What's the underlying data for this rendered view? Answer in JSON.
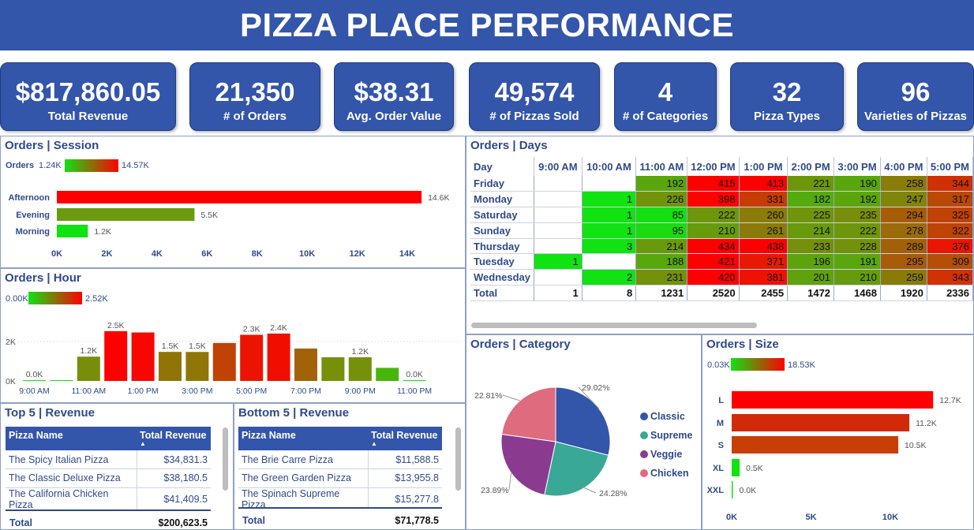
{
  "title": "PIZZA PLACE PERFORMANCE",
  "kpis": [
    {
      "value": "$817,860.05",
      "label": "Total Revenue"
    },
    {
      "value": "21,350",
      "label": "# of Orders"
    },
    {
      "value": "$38.31",
      "label": "Avg. Order Value"
    },
    {
      "value": "49,574",
      "label": "# of Pizzas Sold"
    },
    {
      "value": "4",
      "label": "# of Categories"
    },
    {
      "value": "32",
      "label": "Pizza  Types"
    },
    {
      "value": "96",
      "label": "Varieties of Pizzas"
    }
  ],
  "session": {
    "title": "Orders | Session",
    "legend_label": "Orders",
    "legend_min": "1.24K",
    "legend_max": "14.57K"
  },
  "hour": {
    "title": "Orders | Hour",
    "legend_min": "0.00K",
    "legend_max": "2.52K"
  },
  "days": {
    "title": "Orders | Days",
    "header_day": "Day",
    "hours": [
      "9:00 AM",
      "10:00 AM",
      "11:00 AM",
      "12:00 PM",
      "1:00 PM",
      "2:00 PM",
      "3:00 PM",
      "4:00 PM",
      "5:00 PM"
    ],
    "rows": [
      {
        "day": "Friday",
        "values": [
          "",
          "",
          "192",
          "415",
          "413",
          "221",
          "190",
          "258",
          "344"
        ]
      },
      {
        "day": "Monday",
        "values": [
          "",
          "1",
          "226",
          "398",
          "331",
          "182",
          "192",
          "247",
          "317"
        ]
      },
      {
        "day": "Saturday",
        "values": [
          "",
          "1",
          "85",
          "222",
          "260",
          "225",
          "235",
          "294",
          "325"
        ]
      },
      {
        "day": "Sunday",
        "values": [
          "",
          "1",
          "95",
          "210",
          "261",
          "214",
          "222",
          "278",
          "322"
        ]
      },
      {
        "day": "Thursday",
        "values": [
          "",
          "3",
          "214",
          "434",
          "438",
          "233",
          "228",
          "289",
          "376"
        ]
      },
      {
        "day": "Tuesday",
        "values": [
          "1",
          "",
          "188",
          "421",
          "371",
          "196",
          "191",
          "295",
          "309"
        ]
      },
      {
        "day": "Wednesday",
        "values": [
          "",
          "2",
          "231",
          "420",
          "381",
          "201",
          "210",
          "259",
          "343"
        ]
      }
    ],
    "total_label": "Total",
    "totals": [
      "1",
      "8",
      "1231",
      "2520",
      "2455",
      "1472",
      "1468",
      "1920",
      "2336"
    ]
  },
  "category": {
    "title": "Orders | Category",
    "legend": [
      "Classic",
      "Supreme",
      "Veggie",
      "Chicken"
    ],
    "colors": [
      "#3355aa",
      "#3aa897",
      "#8a3b8f",
      "#de6b7e"
    ]
  },
  "size": {
    "title": "Orders | Size",
    "legend_min": "0.03K",
    "legend_max": "18.53K"
  },
  "top5": {
    "title": "Top 5 | Revenue",
    "col1": "Pizza Name",
    "col2": "Total Revenue",
    "rows": [
      {
        "name": "The Spicy Italian Pizza",
        "value": "$34,831.3"
      },
      {
        "name": "The Classic Deluxe Pizza",
        "value": "$38,180.5"
      },
      {
        "name": "The California Chicken Pizza",
        "value": "$41,409.5"
      }
    ],
    "total_label": "Total",
    "total_value": "$200,623.5"
  },
  "bottom5": {
    "title": "Bottom 5 | Revenue",
    "col1": "Pizza Name",
    "col2": "Total Revenue",
    "rows": [
      {
        "name": "The Brie Carre Pizza",
        "value": "$11,588.5"
      },
      {
        "name": "The Green Garden Pizza",
        "value": "$13,955.8"
      },
      {
        "name": "The Spinach Supreme Pizza",
        "value": "$15,277.8"
      }
    ],
    "total_label": "Total",
    "total_value": "$71,778.5"
  },
  "chart_data": [
    {
      "type": "bar",
      "orientation": "horizontal",
      "categories": [
        "Afternoon",
        "Evening",
        "Morning"
      ],
      "values": [
        14570,
        5500,
        1240
      ],
      "data_labels": [
        "14.6K",
        "5.5K",
        "1.2K"
      ],
      "xticks": [
        "0K",
        "2K",
        "4K",
        "6K",
        "8K",
        "10K",
        "12K",
        "14K"
      ],
      "xlim": [
        0,
        14000
      ],
      "colors": [
        "#ff0000",
        "#6a9a10",
        "#11e211"
      ]
    },
    {
      "type": "bar",
      "hours": [
        9,
        10,
        11,
        12,
        13,
        14,
        15,
        16,
        17,
        18,
        19,
        20,
        21,
        22,
        23
      ],
      "values": [
        1,
        8,
        1231,
        2520,
        2455,
        1472,
        1468,
        1920,
        2336,
        2399,
        1642,
        1198,
        1198,
        663,
        28
      ],
      "labels": [
        "0.0K",
        "",
        "1.2K",
        "2.5K",
        "",
        "1.5K",
        "1.5K",
        "",
        "2.3K",
        "2.4K",
        "",
        "",
        "1.2K",
        "",
        "0.0K"
      ],
      "xticks": [
        "9:00 AM",
        "11:00 AM",
        "1:00 PM",
        "3:00 PM",
        "5:00 PM",
        "7:00 PM",
        "9:00 PM",
        "11:00 PM"
      ],
      "yticks": [
        "0K",
        "2K"
      ],
      "ylim": [
        0,
        2600
      ]
    },
    {
      "type": "pie",
      "labels": [
        "Classic",
        "Supreme",
        "Veggie",
        "Chicken"
      ],
      "values": [
        29.02,
        24.28,
        23.89,
        22.81
      ],
      "data_labels": [
        "29.02%",
        "24.28%",
        "23.89%",
        "22.81%"
      ]
    },
    {
      "type": "bar",
      "orientation": "horizontal",
      "categories": [
        "L",
        "M",
        "S",
        "XL",
        "XXL"
      ],
      "values": [
        12700,
        11200,
        10500,
        500,
        30
      ],
      "data_labels": [
        "12.7K",
        "11.2K",
        "10.5K",
        "0.5K",
        "0.0K"
      ],
      "xticks": [
        "0K",
        "5K",
        "10K"
      ],
      "xlim": [
        0,
        14000
      ],
      "colors": [
        "#ff0000",
        "#d22a08",
        "#c93d06",
        "#11e211",
        "#11e211"
      ]
    }
  ]
}
